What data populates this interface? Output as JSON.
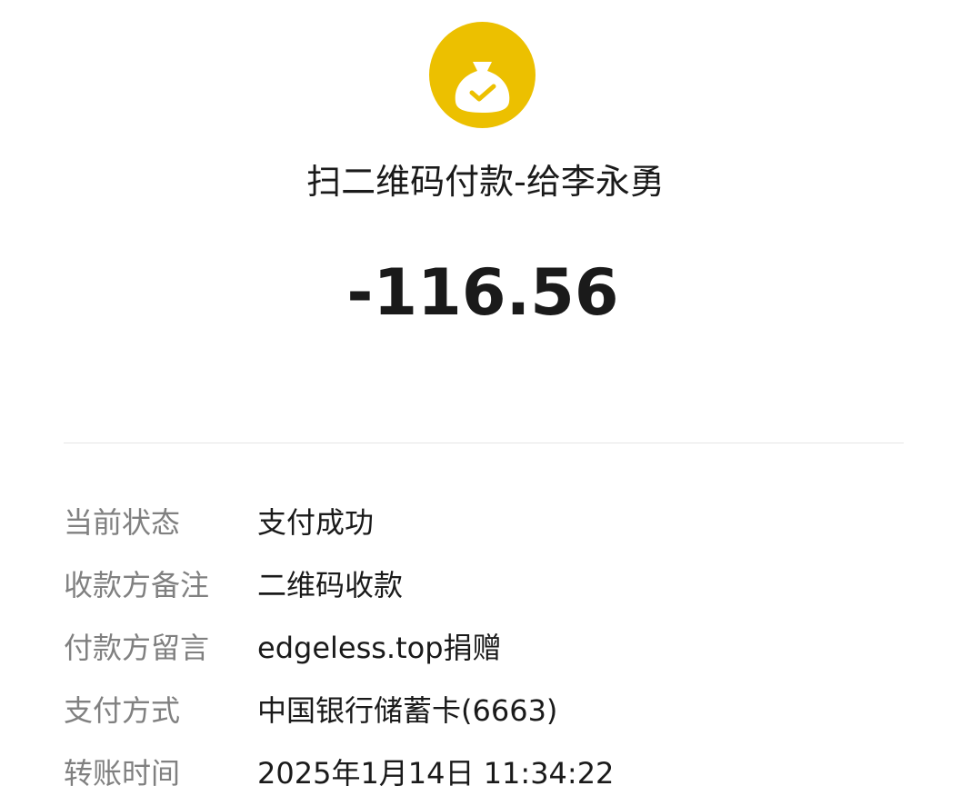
{
  "header": {
    "icon": "money-bag-check-icon",
    "icon_color": "#ECC000",
    "title": "扫二维码付款-给李永勇",
    "amount": "-116.56"
  },
  "details": {
    "rows": [
      {
        "label": "当前状态",
        "value": "支付成功"
      },
      {
        "label": "收款方备注",
        "value": "二维码收款"
      },
      {
        "label": "付款方留言",
        "value": "edgeless.top捐赠"
      },
      {
        "label": "支付方式",
        "value": "中国银行储蓄卡(6663)"
      },
      {
        "label": "转账时间",
        "value": "2025年1月14日 11:34:22"
      }
    ]
  }
}
